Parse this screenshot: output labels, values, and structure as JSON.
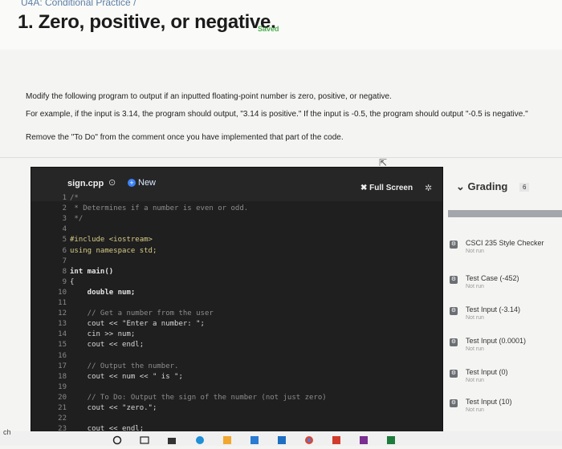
{
  "breadcrumb": "U4A: Conditional Practice /",
  "page_title": "1. Zero, positive, or negative.",
  "saved_label": "Saved",
  "instructions": [
    "Modify the following program to output if an inputted floating-point number is zero, positive, or negative.",
    "For example, if the input is 3.14, the program should output, \"3.14 is positive.\" If the input is -0.5, the program should output \"-0.5 is negative.\"",
    "Remove the \"To Do\" from the comment once you have implemented that part of the code."
  ],
  "editor": {
    "filename": "sign.cpp",
    "new_label": "New",
    "fullscreen_label": "Full Screen",
    "lines": [
      {
        "n": "1",
        "text": "/*"
      },
      {
        "n": "2",
        "text": " * Determines if a number is even or odd."
      },
      {
        "n": "3",
        "text": " */"
      },
      {
        "n": "4",
        "text": ""
      },
      {
        "n": "5",
        "text": "#include <iostream>"
      },
      {
        "n": "6",
        "text": "using namespace std;"
      },
      {
        "n": "7",
        "text": ""
      },
      {
        "n": "8",
        "text": "int main()"
      },
      {
        "n": "9",
        "text": "{"
      },
      {
        "n": "10",
        "text": "    double num;"
      },
      {
        "n": "11",
        "text": ""
      },
      {
        "n": "12",
        "text": "    // Get a number from the user"
      },
      {
        "n": "13",
        "text": "    cout << \"Enter a number: \";"
      },
      {
        "n": "14",
        "text": "    cin >> num;"
      },
      {
        "n": "15",
        "text": "    cout << endl;"
      },
      {
        "n": "16",
        "text": ""
      },
      {
        "n": "17",
        "text": "    // Output the number."
      },
      {
        "n": "18",
        "text": "    cout << num << \" is \";"
      },
      {
        "n": "19",
        "text": ""
      },
      {
        "n": "20",
        "text": "    // To Do: Output the sign of the number (not just zero)"
      },
      {
        "n": "21",
        "text": "    cout << \"zero.\";"
      },
      {
        "n": "22",
        "text": ""
      },
      {
        "n": "23",
        "text": "    cout << endl;"
      }
    ]
  },
  "grading": {
    "title": "Grading",
    "count": "6",
    "tests": [
      {
        "name": "CSCI 235 Style Checker",
        "status": "Not run"
      },
      {
        "name": "Test Case (-452)",
        "status": "Not run"
      },
      {
        "name": "Test Input (-3.14)",
        "status": "Not run"
      },
      {
        "name": "Test Input (0.0001)",
        "status": "Not run"
      },
      {
        "name": "Test Input (0)",
        "status": "Not run"
      },
      {
        "name": "Test Input (10)",
        "status": "Not run"
      }
    ]
  },
  "taskbar_text": "ch"
}
